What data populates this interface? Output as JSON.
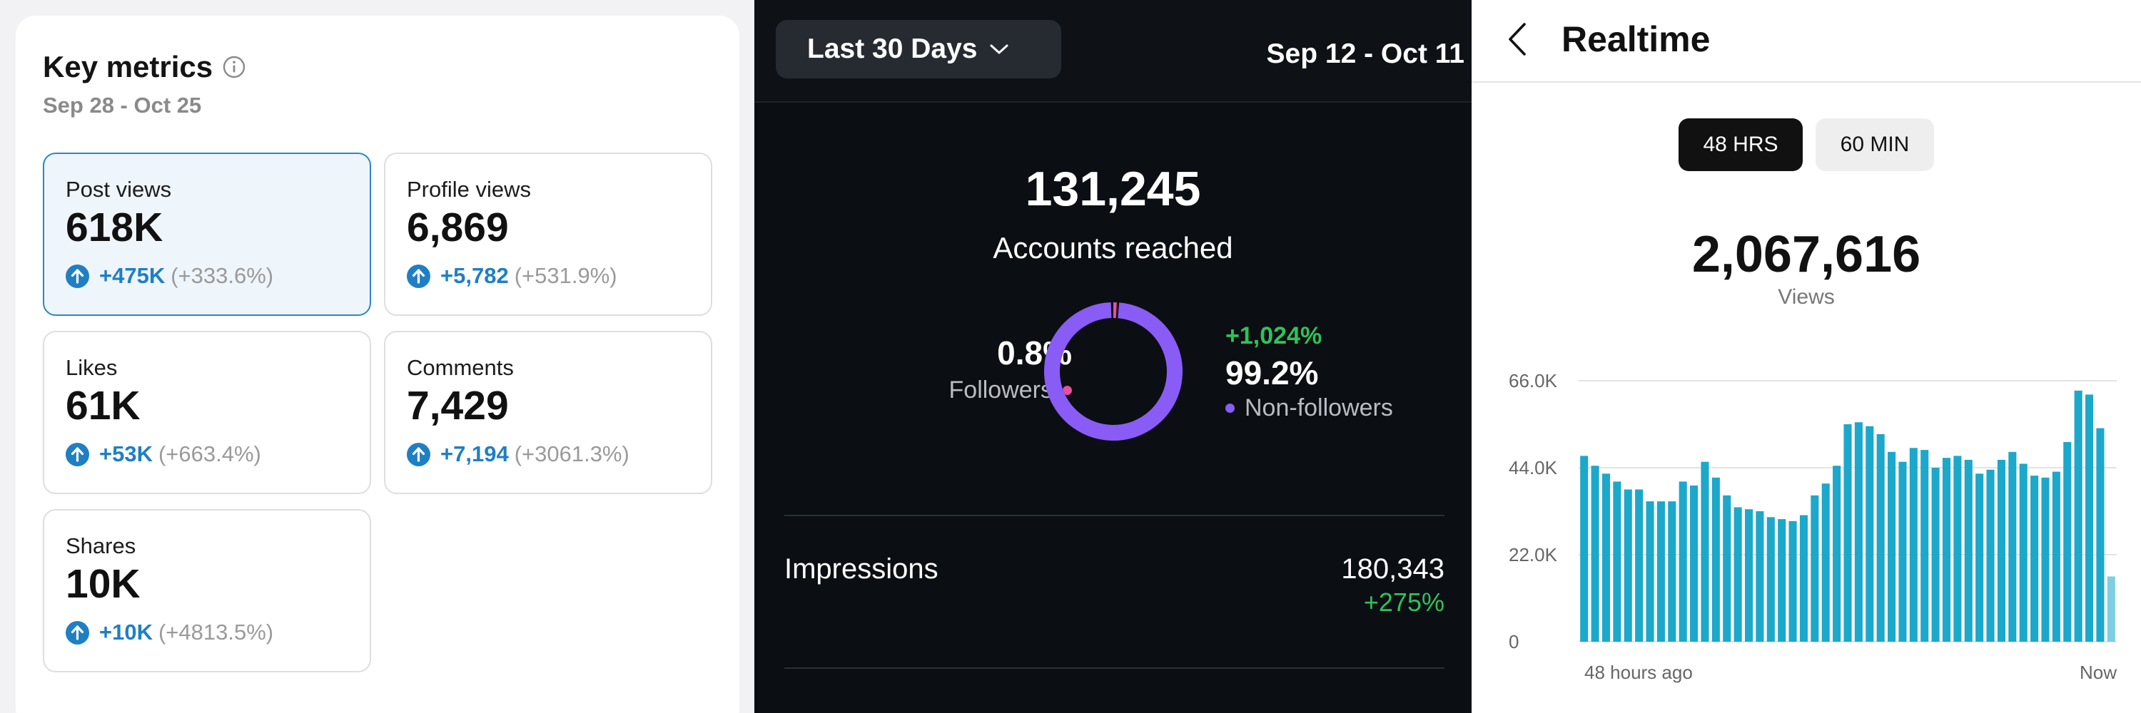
{
  "key_metrics": {
    "title": "Key metrics",
    "date_range": "Sep 28 - Oct 25",
    "cards": [
      {
        "label": "Post views",
        "value": "618K",
        "delta_abs": "+475K",
        "delta_pct": "(+333.6%)",
        "selected": true
      },
      {
        "label": "Profile views",
        "value": "6,869",
        "delta_abs": "+5,782",
        "delta_pct": "(+531.9%)",
        "selected": false
      },
      {
        "label": "Likes",
        "value": "61K",
        "delta_abs": "+53K",
        "delta_pct": "(+663.4%)",
        "selected": false
      },
      {
        "label": "Comments",
        "value": "7,429",
        "delta_abs": "+7,194",
        "delta_pct": "(+3061.3%)",
        "selected": false
      },
      {
        "label": "Shares",
        "value": "10K",
        "delta_abs": "+10K",
        "delta_pct": "(+4813.5%)",
        "selected": false
      }
    ],
    "colors": {
      "accent": "#1f7fc4",
      "selected_bg": "#eef5fb"
    }
  },
  "reach": {
    "range_label": "Last 30 Days",
    "date": "Sep 12 - Oct 11",
    "accounts_value": "131,245",
    "accounts_label": "Accounts reached",
    "followers_pct": "0.8%",
    "followers_label": "Followers",
    "followers_share": 0.008,
    "nonfollowers_delta": "+1,024%",
    "nonfollowers_pct": "99.2%",
    "nonfollowers_label": "Non-followers",
    "impressions_label": "Impressions",
    "impressions_value": "180,343",
    "impressions_delta": "+275%",
    "colors": {
      "followers": "#e84f9b",
      "nonfollowers": "#8a5cf6",
      "positive": "#2fc25b"
    }
  },
  "realtime": {
    "title": "Realtime",
    "tabs": [
      "48 HRS",
      "60 MIN"
    ],
    "active_tab": "48 HRS",
    "views_value": "2,067,616",
    "views_label": "Views"
  },
  "chart_data": {
    "type": "bar",
    "ylim": [
      0,
      66000
    ],
    "yticks": [
      0,
      22000,
      44000,
      66000
    ],
    "ytick_labels": [
      "0",
      "22.0K",
      "44.0K",
      "66.0K"
    ],
    "xlabel_start": "48 hours ago",
    "xlabel_end": "Now",
    "grid": true,
    "colors": {
      "bar": "#1ba8cb",
      "bar_partial": "#7dcfe3"
    },
    "values": [
      47000,
      44500,
      42500,
      40500,
      38500,
      38500,
      35500,
      35500,
      35500,
      40500,
      39500,
      45500,
      41500,
      37000,
      34000,
      33500,
      33000,
      31500,
      31000,
      30500,
      32000,
      37000,
      40000,
      44500,
      55000,
      55500,
      54500,
      52500,
      48000,
      45500,
      49000,
      48500,
      44000,
      46500,
      47000,
      46000,
      42500,
      43500,
      46000,
      48000,
      45000,
      42000,
      41500,
      43000,
      50500,
      63500,
      62500,
      54000,
      16500
    ]
  }
}
